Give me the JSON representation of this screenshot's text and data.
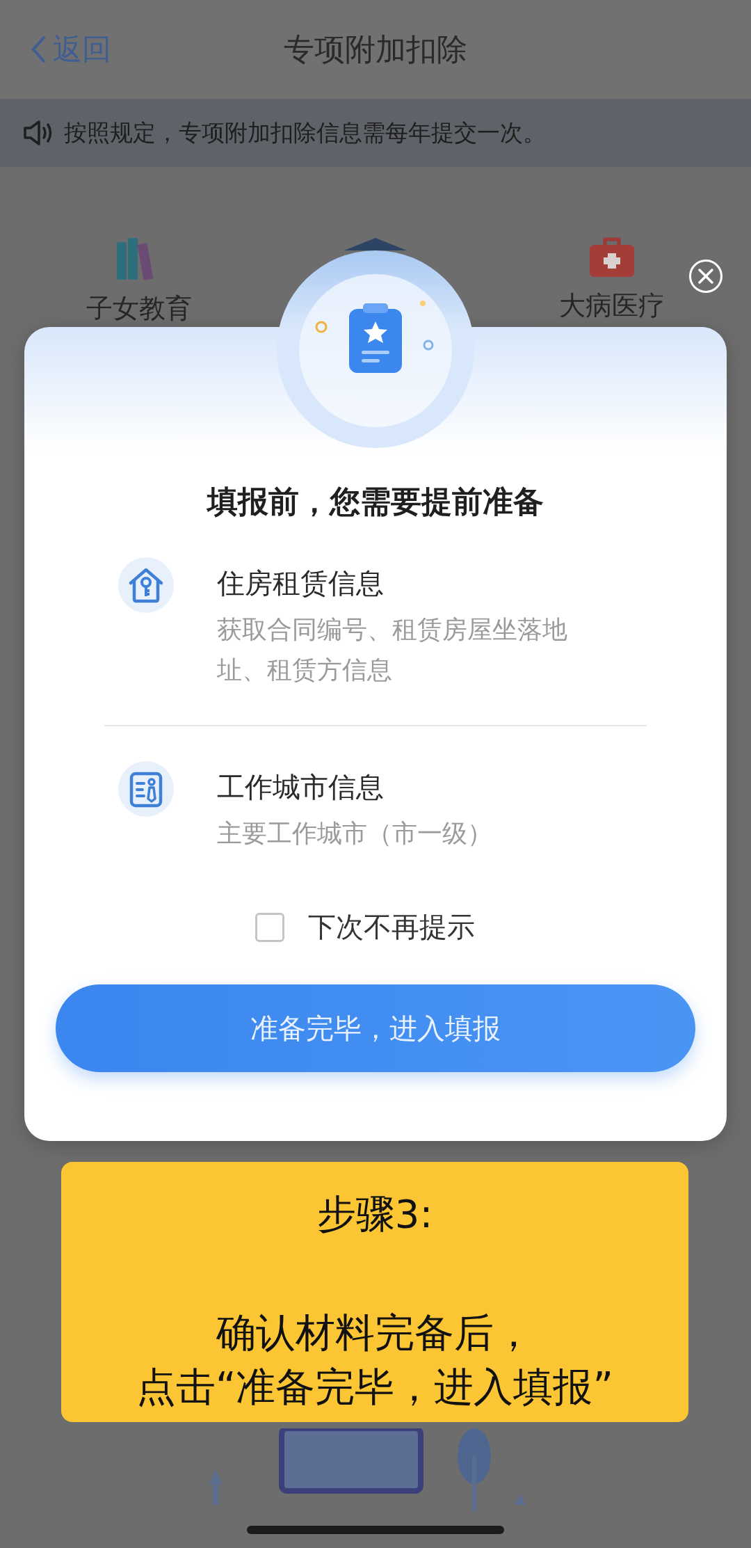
{
  "nav": {
    "back": "返回",
    "title": "专项附加扣除"
  },
  "notice": "按照规定，专项附加扣除信息需每年提交一次。",
  "categories": [
    {
      "kind": "books",
      "label": "子女教育"
    },
    {
      "kind": "cap"
    },
    {
      "kind": "medkit",
      "label": "大病医疗"
    }
  ],
  "dialog": {
    "heading": "填报前，您需要提前准备",
    "items": [
      {
        "kind": "house-key",
        "title": "住房租赁信息",
        "desc": "获取合同编号、租赁房屋坐落地址、租赁方信息"
      },
      {
        "kind": "id-card",
        "title": "工作城市信息",
        "desc": "主要工作城市（市一级）"
      }
    ],
    "dont_show_again": {
      "label": "下次不再提示",
      "checked": false
    },
    "confirm_button": "准备完毕，进入填报"
  },
  "annotation": {
    "step": "步骤3:",
    "lines": [
      "确认材料完备后，",
      "点击“准备完毕，进入填报”"
    ]
  }
}
